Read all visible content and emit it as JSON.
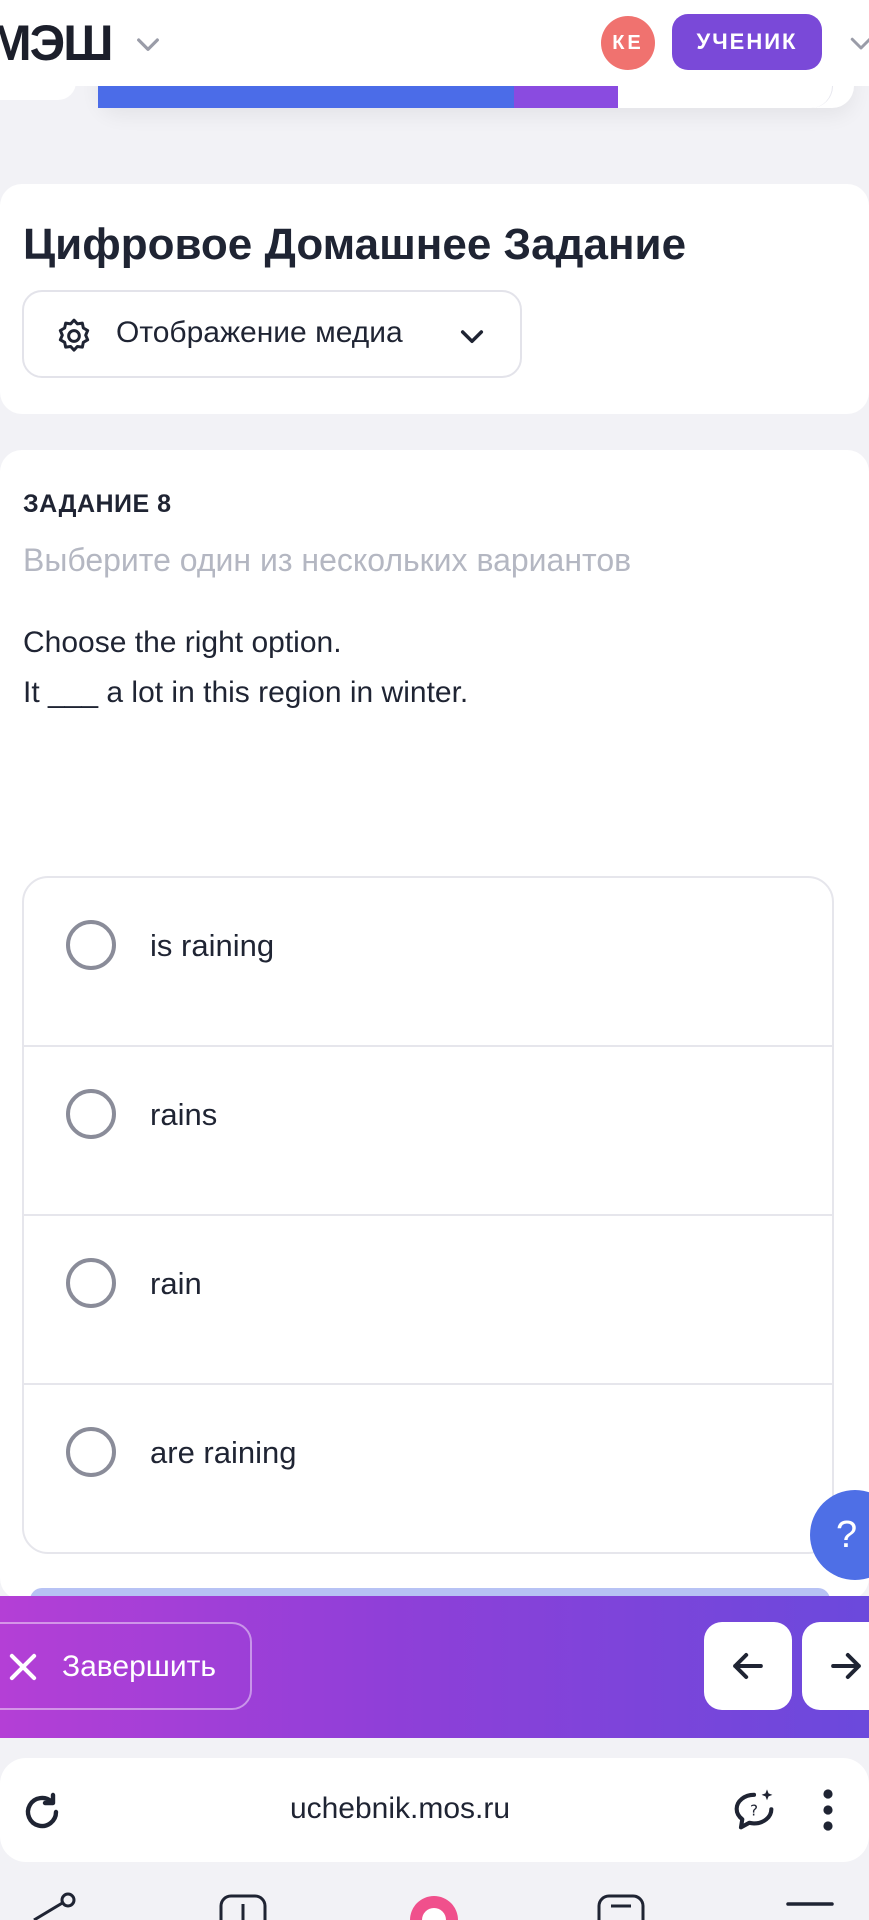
{
  "header": {
    "logo": "МЭШ",
    "avatar_initials": "КЕ",
    "role_label": "УЧЕНИК"
  },
  "progress": {
    "segments": [
      "done",
      "done",
      "done",
      "done",
      "current",
      "empty",
      "empty"
    ]
  },
  "page": {
    "title": "Цифровое Домашнее Задание",
    "media_button_label": "Отображение медиа"
  },
  "task": {
    "number_label": "ЗАДАНИЕ 8",
    "hint": "Выберите один из нескольких вариантов",
    "instruction": "Choose the right option.",
    "sentence": "It ___ a lot in this region in winter.",
    "options": [
      {
        "label": "is raining",
        "selected": false
      },
      {
        "label": "rains",
        "selected": false
      },
      {
        "label": "rain",
        "selected": false
      },
      {
        "label": "are raining",
        "selected": false
      }
    ]
  },
  "help": {
    "label": "?"
  },
  "actions": {
    "finish_label": "Завершить"
  },
  "browser": {
    "url": "uchebnik.mos.ru"
  },
  "colors": {
    "accent_purple": "#7a49d8",
    "progress_blue": "#4b6ce8",
    "avatar_red": "#f0726f",
    "help_blue": "#4e6fe6"
  }
}
